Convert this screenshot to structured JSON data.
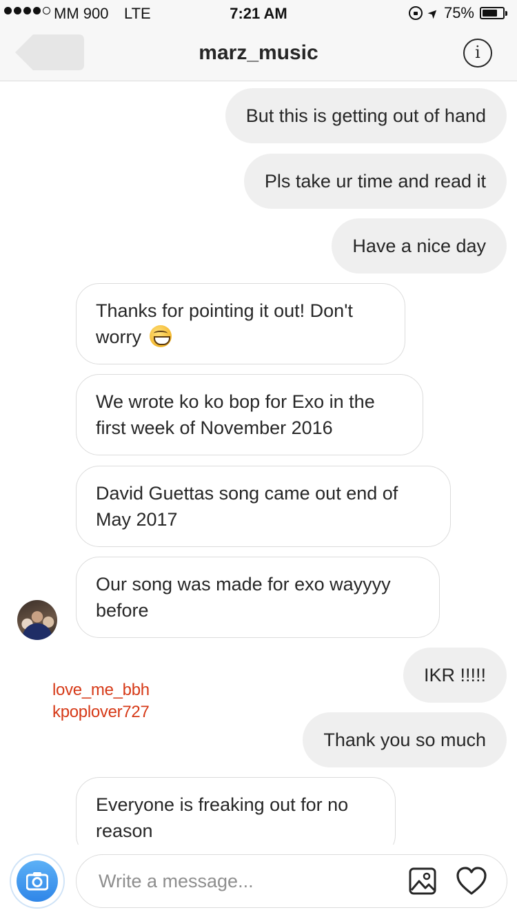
{
  "status_bar": {
    "carrier": "MM 900",
    "network": "LTE",
    "time": "7:21 AM",
    "battery_percent": "75%",
    "battery_level": 0.75,
    "signal_bars_filled": 4,
    "signal_bars_total": 5
  },
  "header": {
    "title": "marz_music",
    "info_label": "i"
  },
  "messages": [
    {
      "side": "out",
      "text": "But this is getting out of hand"
    },
    {
      "side": "out",
      "text": "Pls take ur time and read it"
    },
    {
      "side": "out",
      "text": "Have a nice day"
    },
    {
      "side": "in",
      "text": "Thanks for pointing it out! Don't worry"
    },
    {
      "side": "in",
      "text": "We wrote ko ko bop for Exo in the first week of November 2016"
    },
    {
      "side": "in",
      "text": "David Guettas song came out end of May 2017"
    },
    {
      "side": "in",
      "text": "Our song was made for exo wayyyy before"
    },
    {
      "side": "out",
      "text": "IKR !!!!!"
    },
    {
      "side": "out",
      "text": "Thank you so much"
    },
    {
      "side": "in",
      "text": "Everyone is freaking out for no reason"
    }
  ],
  "watermark": {
    "line1": "love_me_bbh",
    "line2": "kpoplover727",
    "color": "#d63a18"
  },
  "composer": {
    "placeholder": "Write a message..."
  },
  "icons": {
    "back": "back-arrow-icon",
    "info": "info-icon",
    "camera": "camera-icon",
    "gallery": "gallery-icon",
    "heart": "heart-icon",
    "emoji": "grinning-face-emoji"
  },
  "colors": {
    "outgoing_bubble": "#efefef",
    "incoming_border": "#dbdbdb",
    "camera_blue": "#3897f0"
  }
}
